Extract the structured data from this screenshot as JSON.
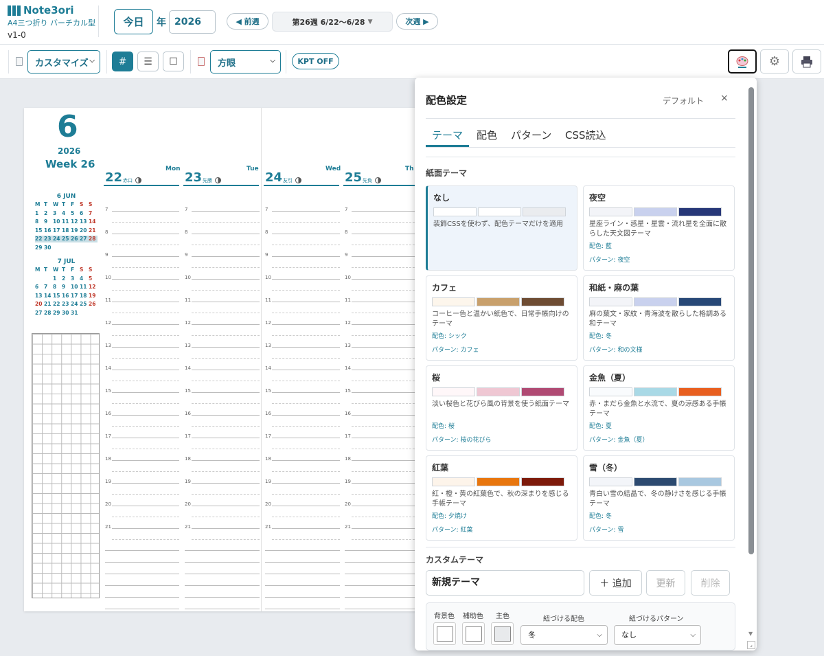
{
  "app": {
    "title": "Note3ori",
    "subtitle": "A4三つ折り バーチカル型",
    "version": "v1-0"
  },
  "nav": {
    "today": "今日",
    "year_label": "年",
    "year": "2026",
    "prev": "◀ 前週",
    "next": "次週 ▶",
    "week": "第26週 6/22〜6/28"
  },
  "toolbar": {
    "customize": "カスタマイズ",
    "grid_style": "方眼",
    "kpt": "KPT OFF"
  },
  "planner": {
    "month": "6",
    "year": "2026",
    "week": "Week 26",
    "days": [
      {
        "num": "22",
        "name": "Mon",
        "rokuyo": "赤口"
      },
      {
        "num": "23",
        "name": "Tue",
        "rokuyo": "先勝"
      },
      {
        "num": "24",
        "name": "Wed",
        "rokuyo": "友引"
      },
      {
        "num": "25",
        "name": "Th",
        "rokuyo": "先負"
      }
    ],
    "hours": [
      "7",
      "8",
      "9",
      "10",
      "11",
      "12",
      "13",
      "14",
      "15",
      "16",
      "17",
      "18",
      "19",
      "20",
      "21"
    ],
    "mini_june": {
      "title": "6 JUN",
      "dow": [
        "M",
        "T",
        "W",
        "T",
        "F",
        "S",
        "S"
      ],
      "days": [
        "1",
        "2",
        "3",
        "4",
        "5",
        "6",
        "7",
        "8",
        "9",
        "10",
        "11",
        "12",
        "13",
        "14",
        "15",
        "16",
        "17",
        "18",
        "19",
        "20",
        "21",
        "22",
        "23",
        "24",
        "25",
        "26",
        "27",
        "28",
        "29",
        "30"
      ]
    },
    "mini_july": {
      "title": "7 JUL",
      "dow": [
        "M",
        "T",
        "W",
        "T",
        "F",
        "S",
        "S"
      ],
      "days": [
        "1",
        "2",
        "3",
        "4",
        "5",
        "6",
        "7",
        "8",
        "9",
        "10",
        "11",
        "12",
        "13",
        "14",
        "15",
        "16",
        "17",
        "18",
        "19",
        "20",
        "21",
        "22",
        "23",
        "24",
        "25",
        "26",
        "27",
        "28",
        "29",
        "30",
        "31"
      ]
    }
  },
  "panel": {
    "title": "配色設定",
    "default": "デフォルト",
    "close": "×",
    "tabs": [
      "テーマ",
      "配色",
      "パターン",
      "CSS読込"
    ],
    "section": "紙面テーマ",
    "themes": [
      {
        "name": "なし",
        "colors": [
          "#ffffff",
          "#ffffff",
          "#eaecef"
        ],
        "desc": "装飾CSSを使わず、配色テーマだけを適用",
        "color": "",
        "pattern": ""
      },
      {
        "name": "夜空",
        "colors": [
          "#f3f4f8",
          "#c9d1ee",
          "#273778"
        ],
        "desc": "星座ライン・惑星・星雲・流れ星を全面に散らした天文図テーマ",
        "color": "配色: 藍",
        "pattern": "パターン: 夜空"
      },
      {
        "name": "カフェ",
        "colors": [
          "#fdf6ec",
          "#c8a06c",
          "#6e4c33"
        ],
        "desc": "コーヒー色と温かい紙色で、日常手帳向けのテーマ",
        "color": "配色: シック",
        "pattern": "パターン: カフェ"
      },
      {
        "name": "和紙・麻の葉",
        "colors": [
          "#f3f4f8",
          "#c9d1ee",
          "#274877"
        ],
        "desc": "麻の葉文・家紋・青海波を散らした格調ある和テーマ",
        "color": "配色: 冬",
        "pattern": "パターン: 和の文様"
      },
      {
        "name": "桜",
        "colors": [
          "#fff7f9",
          "#efc7d3",
          "#b04a73"
        ],
        "desc": "淡い桜色と花びら風の背景を使う紙面テーマ",
        "color": "配色: 桜",
        "pattern": "パターン: 桜の花びら"
      },
      {
        "name": "金魚（夏）",
        "colors": [
          "#f9fbfd",
          "#a9d9e6",
          "#e85f20"
        ],
        "desc": "赤・まだら金魚と水流で、夏の涼感ある手帳テーマ",
        "color": "配色: 夏",
        "pattern": "パターン: 金魚（夏）"
      },
      {
        "name": "紅葉",
        "colors": [
          "#fdf4ea",
          "#e8760e",
          "#7d1a0a"
        ],
        "desc": "紅・橙・黄の紅葉色で、秋の深まりを感じる手帳テーマ",
        "color": "配色: 夕焼け",
        "pattern": "パターン: 紅葉"
      },
      {
        "name": "雪（冬）",
        "colors": [
          "#f3f5f9",
          "#2c4a70",
          "#a9c8e0"
        ],
        "desc": "青白い雪の結晶で、冬の静けさを感じる手帳テーマ",
        "color": "配色: 冬",
        "pattern": "パターン: 雪"
      }
    ],
    "custom": {
      "section": "カスタムテーマ",
      "name": "新規テーマ",
      "add": "＋ 追加",
      "update": "更新",
      "delete": "削除",
      "bg_label": "背景色",
      "sub_label": "補助色",
      "main_label": "主色",
      "color_label": "紐づける配色",
      "pattern_label": "紐づけるパターン",
      "color_value": "冬",
      "pattern_value": "なし"
    }
  }
}
